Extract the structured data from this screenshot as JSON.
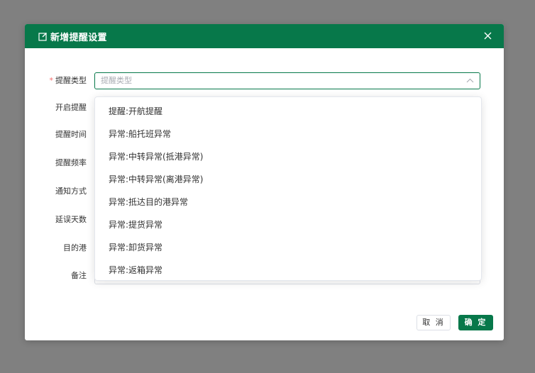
{
  "colors": {
    "primary": "#07784a",
    "required": "#f56c6c",
    "backdrop": "#808080"
  },
  "dialog": {
    "title": "新增提醒设置",
    "title_icon": "edit-icon",
    "close_icon": "close-icon"
  },
  "form": {
    "fields": [
      {
        "label": "提醒类型",
        "required": true
      },
      {
        "label": "开启提醒",
        "required": false
      },
      {
        "label": "提醒时间",
        "required": false
      },
      {
        "label": "提醒频率",
        "required": false
      },
      {
        "label": "通知方式",
        "required": false
      },
      {
        "label": "延误天数",
        "required": false
      },
      {
        "label": "目的港",
        "required": false
      },
      {
        "label": "备注",
        "required": false
      }
    ],
    "required_mark": "*",
    "reminder_type": {
      "placeholder": "提醒类型",
      "value": "",
      "icon": "chevron-up-icon"
    }
  },
  "dropdown": {
    "options": [
      "提醒:开航提醒",
      "异常:船托班异常",
      "异常:中转异常(抵港异常)",
      "异常:中转异常(离港异常)",
      "异常:抵达目的港异常",
      "异常:提货异常",
      "异常:卸货异常",
      "异常:返箱异常"
    ]
  },
  "footer": {
    "cancel_label": "取 消",
    "confirm_label": "确 定"
  }
}
